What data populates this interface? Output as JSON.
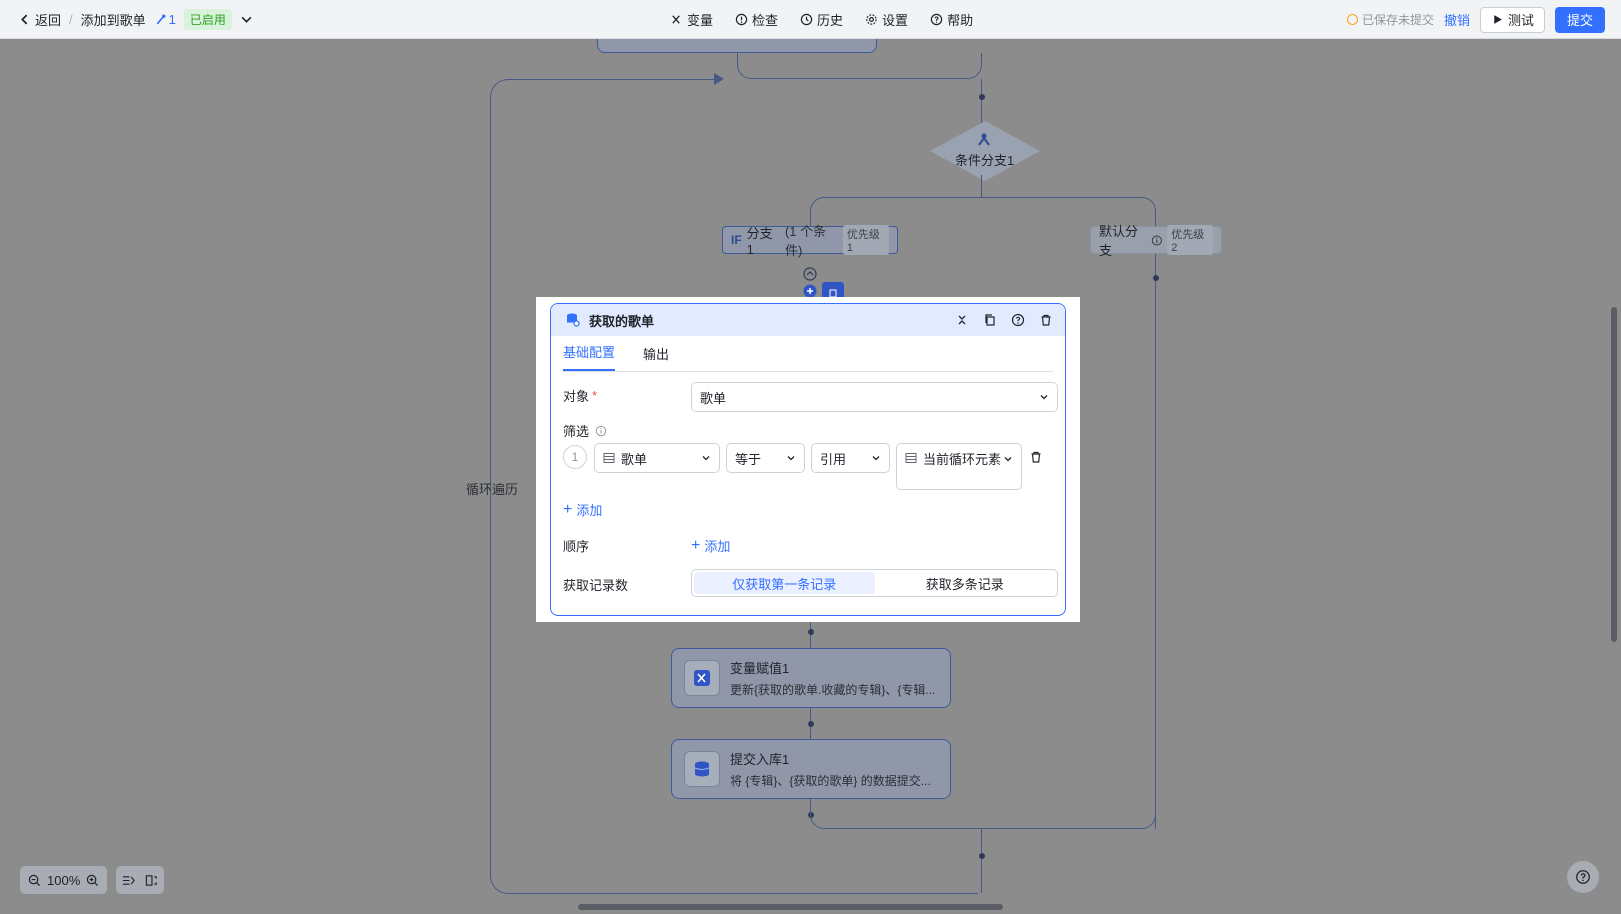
{
  "topbar": {
    "back_label": "返回",
    "breadcrumb_sep": "/",
    "flow_name": "添加到歌单",
    "version": "1",
    "status": "已启用",
    "center": [
      {
        "key": "vars",
        "label": "变量",
        "icon": "variable-icon"
      },
      {
        "key": "check",
        "label": "检查",
        "icon": "alert-circle-icon"
      },
      {
        "key": "history",
        "label": "历史",
        "icon": "history-icon"
      },
      {
        "key": "settings",
        "label": "设置",
        "icon": "gear-icon"
      },
      {
        "key": "help",
        "label": "帮助",
        "icon": "question-icon"
      }
    ],
    "save_status": "已保存未提交",
    "revoke_label": "撤销",
    "test_label": "测试",
    "submit_label": "提交"
  },
  "canvas": {
    "loop_label": "循环遍历",
    "condition_node": {
      "title": "条件分支1"
    },
    "if_branch": {
      "tag": "IF",
      "name": "分支 1",
      "cond": "(1 个条件)",
      "priority": "优先级 1"
    },
    "default_branch": {
      "name": "默认分支",
      "priority": "优先级 2"
    },
    "node_assign": {
      "title": "变量赋值1",
      "desc": "更新{获取的歌单.收藏的专辑}、{专辑...",
      "icon": "variable-assign-icon"
    },
    "node_commit": {
      "title": "提交入库1",
      "desc": "将 {专辑}、{获取的歌单} 的数据提交...",
      "icon": "database-icon"
    }
  },
  "modal": {
    "title": "获取的歌单",
    "tabs": [
      {
        "label": "基础配置",
        "active": true
      },
      {
        "label": "输出",
        "active": false
      }
    ],
    "object_label": "对象",
    "object_required": "*",
    "object_value": "歌单",
    "filter_label": "筛选",
    "filter_row": {
      "index": "1",
      "field": "歌单",
      "operator": "等于",
      "value_type": "引用",
      "value": "当前循环元素"
    },
    "add_filter_label": "添加",
    "order_label": "顺序",
    "add_order_label": "添加",
    "records_label": "获取记录数",
    "records_options": [
      {
        "label": "仅获取第一条记录",
        "active": true
      },
      {
        "label": "获取多条记录",
        "active": false
      }
    ]
  },
  "bottom": {
    "zoom": "100%"
  },
  "colors": {
    "accent": "#3370ff",
    "canvas_bg": "#8c8c8c",
    "status_green": "#2ea121"
  }
}
